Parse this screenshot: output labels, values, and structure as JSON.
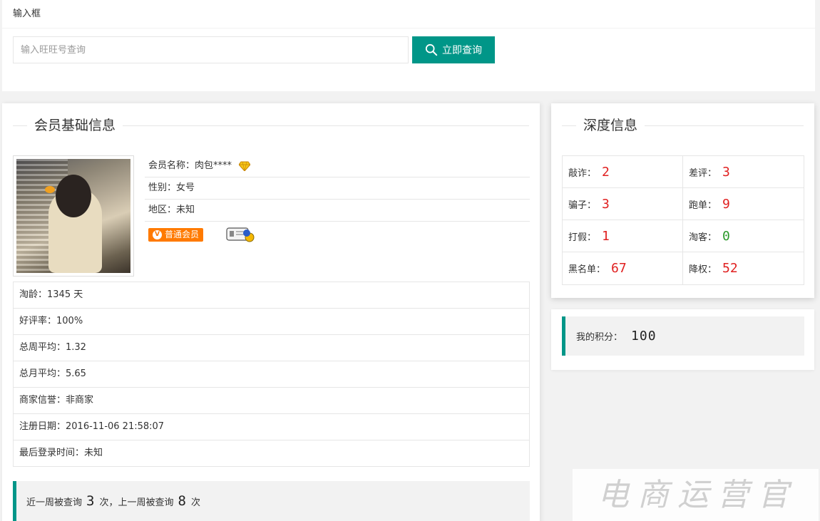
{
  "search": {
    "header": "输入框",
    "placeholder": "输入旺旺号查询",
    "button_label": "立即查询"
  },
  "member_basic": {
    "title": "会员基础信息",
    "name_row": "会员名称：肉包****",
    "gender_row": "性别：女号",
    "region_row": "地区：未知",
    "member_badge": "普通会员",
    "stats": [
      "淘龄：1345 天",
      "好评率：100%",
      "总周平均：1.32",
      "总月平均：5.65",
      "商家信誉：非商家",
      "注册日期：2016-11-06 21:58:07",
      "最后登录时间：未知"
    ],
    "query_summary": {
      "prefix": "近一周被查询",
      "week_count": "3",
      "mid": "次，上一周被查询",
      "last_week_count": "8",
      "suffix": "次"
    }
  },
  "depth_info": {
    "title": "深度信息",
    "cells": [
      {
        "label": "敲诈：",
        "value": "2",
        "color": "#e02020"
      },
      {
        "label": "差评：",
        "value": "3",
        "color": "#e02020"
      },
      {
        "label": "骗子：",
        "value": "3",
        "color": "#e02020"
      },
      {
        "label": "跑单：",
        "value": "9",
        "color": "#e02020"
      },
      {
        "label": "打假：",
        "value": "1",
        "color": "#e02020"
      },
      {
        "label": "淘客：",
        "value": "0",
        "color": "#2a9a2a"
      },
      {
        "label": "黑名单：",
        "value": "67",
        "color": "#e02020"
      },
      {
        "label": "降权：",
        "value": "52",
        "color": "#e02020"
      }
    ]
  },
  "score": {
    "label": "我的积分：",
    "value": "100"
  },
  "watermark": "电商运营官",
  "colors": {
    "accent": "#009688",
    "badge": "#ff7a00",
    "danger": "#e02020",
    "safe": "#2a9a2a"
  }
}
